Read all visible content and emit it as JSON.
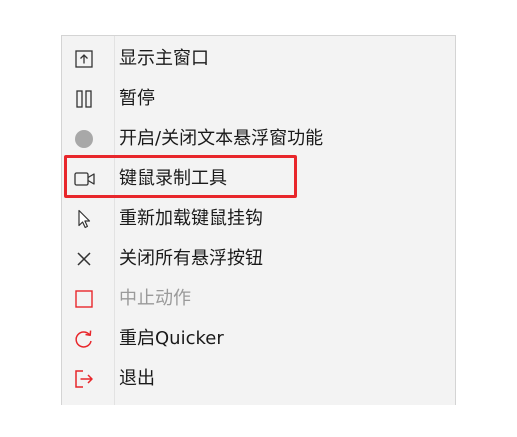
{
  "menu": {
    "items": [
      {
        "label": "显示主窗口",
        "icon": "show-window-icon",
        "enabled": true
      },
      {
        "label": "暂停",
        "icon": "pause-icon",
        "enabled": true
      },
      {
        "label": "开启/关闭文本悬浮窗功能",
        "icon": "circle-icon",
        "enabled": true
      },
      {
        "label": "键鼠录制工具",
        "icon": "video-camera-icon",
        "enabled": true,
        "highlighted": true
      },
      {
        "label": "重新加载键鼠挂钩",
        "icon": "cursor-icon",
        "enabled": true
      },
      {
        "label": "关闭所有悬浮按钮",
        "icon": "close-icon",
        "enabled": true
      },
      {
        "label": "中止动作",
        "icon": "stop-icon",
        "enabled": false
      },
      {
        "label": "重启Quicker",
        "icon": "restart-icon",
        "enabled": true
      },
      {
        "label": "退出",
        "icon": "exit-icon",
        "enabled": true
      }
    ]
  },
  "colors": {
    "highlight_border": "#e8262b",
    "icon_red": "#e8262b",
    "icon_dark": "#333333",
    "icon_gray": "#a8a8a8",
    "menu_background": "#f3f3f3"
  }
}
